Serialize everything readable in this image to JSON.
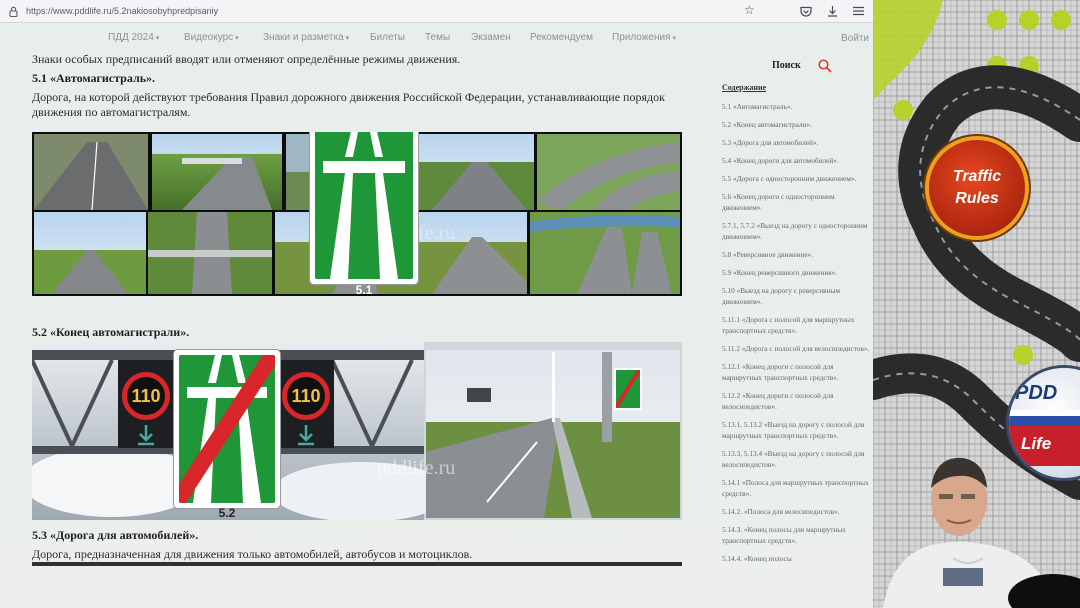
{
  "browser": {
    "url_prefix": "https://",
    "url_host": "www.pdd",
    "url_rest": "life.ru/5.2nakiosobyhpredpisaniy"
  },
  "nav": {
    "items": [
      {
        "label": "ПДД 2024",
        "has_caret": true
      },
      {
        "label": "Видеокурс",
        "has_caret": true
      },
      {
        "label": "Знаки и разметка",
        "has_caret": true
      },
      {
        "label": "Билеты",
        "has_caret": false
      },
      {
        "label": "Темы",
        "has_caret": false
      },
      {
        "label": "Экзамен",
        "has_caret": false
      },
      {
        "label": "Рекомендуем",
        "has_caret": false
      },
      {
        "label": "Приложения",
        "has_caret": true
      }
    ],
    "login": "Войти"
  },
  "content": {
    "intro": "Знаки особых предписаний вводят или отменяют определённые режимы движения.",
    "s51_heading": "5.1 «Автомагистраль».",
    "s51_text": "Дорога, на которой действуют требования Правил дорожного движения Российской Федерации, устанавливающие порядок движения по автомагистралям.",
    "s52_heading": "5.2 «Конец автомагистрали».",
    "s53_heading": "5.3 «Дорога для автомобилей».",
    "s53_text": "Дорога, предназначенная для движения только автомобилей, автобусов и мотоциклов.",
    "sign1_number": "5.1",
    "sign2_number": "5.2",
    "speed_limit": "110",
    "watermark": "pddlife.ru"
  },
  "sidebar": {
    "search_label": "Поиск",
    "toc_title": "Содержание",
    "toc": [
      "5.1 «Автомагистраль».",
      "5.2 «Конец автомагистрали».",
      "5.3 «Дорога для автомобилей».",
      "5.4 «Конец дороги для автомобилей».",
      "5.5 «Дорога с односторонним движением».",
      "5.6 «Конец дороги с односторонним движением».",
      "5.7.1, 5.7.2 «Выезд на дорогу с односторонним движением».",
      "5.8 «Реверсивное движение».",
      "5.9 «Конец реверсивного движения».",
      "5.10 «Выезд на дорогу с реверсивным движением».",
      "5.11.1 «Дорога с полосой для маршрутных транспортных средств».",
      "5.11.2 «Дорога с полосой для велосипедистов».",
      "5.12.1 «Конец дороги с полосой для маршрутных транспортных средств».",
      "5.12.2 «Конец дороги с полосой для велосипедистов».",
      "5.13.1, 5.13.2 «Выезд на дорогу с полосой для маршрутных транспортных средств».",
      "5.13.3, 5.13.4 «Выезд на дорогу с полосой для велосипедистов».",
      "5.14.1 «Полоса для маршрутных транспортных средств».",
      "5.14.2. «Полоса для велосипедистов».",
      "5.14.3. «Конец полосы для маршрутных транспортных средств».",
      "5.14.4. «Конец полосы"
    ]
  },
  "video": {
    "badge1_line1": "Traffic",
    "badge1_line2": "Rules",
    "badge2_line1": "PDD",
    "badge2_line2": "Life"
  },
  "colors": {
    "sign_green": "#1f9638",
    "end_stripe": "#d8262a",
    "toc_link": "#5c6a6a"
  }
}
